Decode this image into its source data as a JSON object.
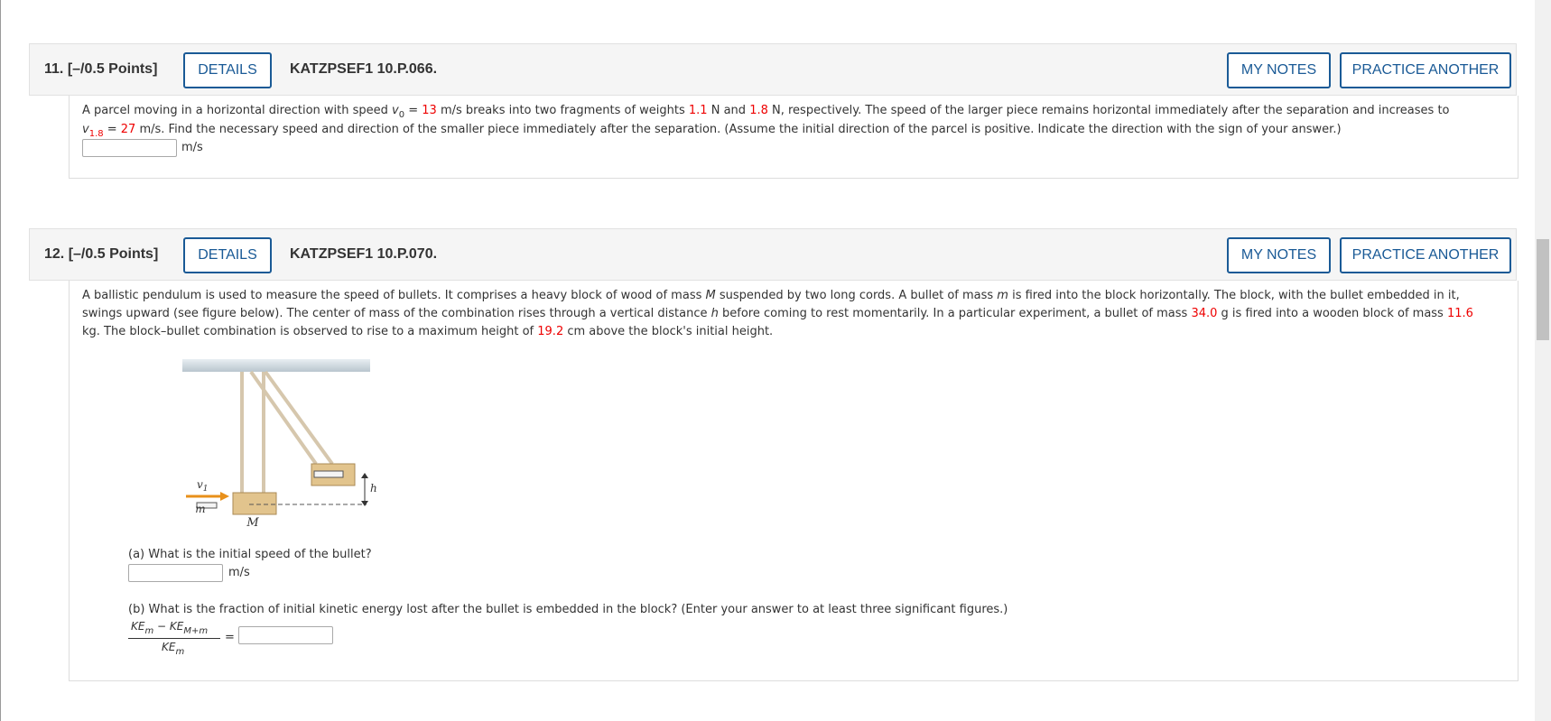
{
  "questions": [
    {
      "number": "11.",
      "points": "[–/0.5 Points]",
      "details_label": "DETAILS",
      "code": "KATZPSEF1 10.P.066.",
      "my_notes_label": "MY NOTES",
      "practice_label": "PRACTICE ANOTHER",
      "text_1": "A parcel moving in a horizontal direction with speed ",
      "v0_symbol": "v",
      "v0_sub": "0",
      "eq": " = ",
      "v0_value": "13",
      "text_2": " m/s breaks into two fragments of weights ",
      "w1": "1.1",
      "text_3": " N and ",
      "w2": "1.8",
      "text_4": " N, respectively. The speed of the larger piece remains horizontal immediately after the separation and increases to",
      "v18_symbol": "v",
      "v18_sub": "1.8",
      "v18_value": "27",
      "text_5": " m/s. Find the necessary speed and direction of the smaller piece immediately after the separation. (Assume the initial direction of the parcel is positive. Indicate the direction with the sign of your answer.)",
      "answer_value": "",
      "unit": "m/s"
    },
    {
      "number": "12.",
      "points": "[–/0.5 Points]",
      "details_label": "DETAILS",
      "code": "KATZPSEF1 10.P.070.",
      "my_notes_label": "MY NOTES",
      "practice_label": "PRACTICE ANOTHER",
      "text_1": "A ballistic pendulum is used to measure the speed of bullets. It comprises a heavy block of wood of mass ",
      "M": "M",
      "text_2": " suspended by two long cords. A bullet of mass ",
      "m": "m",
      "text_3": " is fired into the block horizontally. The block, with the bullet embedded in it, swings upward (see figure below). The center of mass of the combination rises through a vertical distance ",
      "h": "h",
      "text_4": " before coming to rest momentarily. In a particular experiment, a bullet of mass ",
      "bullet_mass": "34.0",
      "text_5": " g is fired into a wooden block of mass ",
      "block_mass": "11.6",
      "text_6": " kg. The block–bullet combination is observed to rise to a maximum height of ",
      "height": "19.2",
      "text_7": " cm above the block's initial height.",
      "figure_labels": {
        "v1": "v",
        "v1_sub": "1",
        "m": "m",
        "M": "M",
        "h": "h"
      },
      "part_a": {
        "question": "(a) What is the initial speed of the bullet?",
        "unit": "m/s",
        "value": ""
      },
      "part_b": {
        "question": "(b) What is the fraction of initial kinetic energy lost after the bullet is embedded in the block? (Enter your answer to at least three significant figures.)",
        "numerator": "KE",
        "num_sub1": "m",
        "minus": " − ",
        "num_sub2": "M+m",
        "denominator": "KE",
        "den_sub": "m",
        "equals": "=",
        "value": ""
      }
    }
  ],
  "colors": {
    "accent": "#1a5a96",
    "highlight": "#e00000",
    "rope": "#d6c7ad",
    "wood": "#e2c48d",
    "arrow": "#e8901a"
  }
}
